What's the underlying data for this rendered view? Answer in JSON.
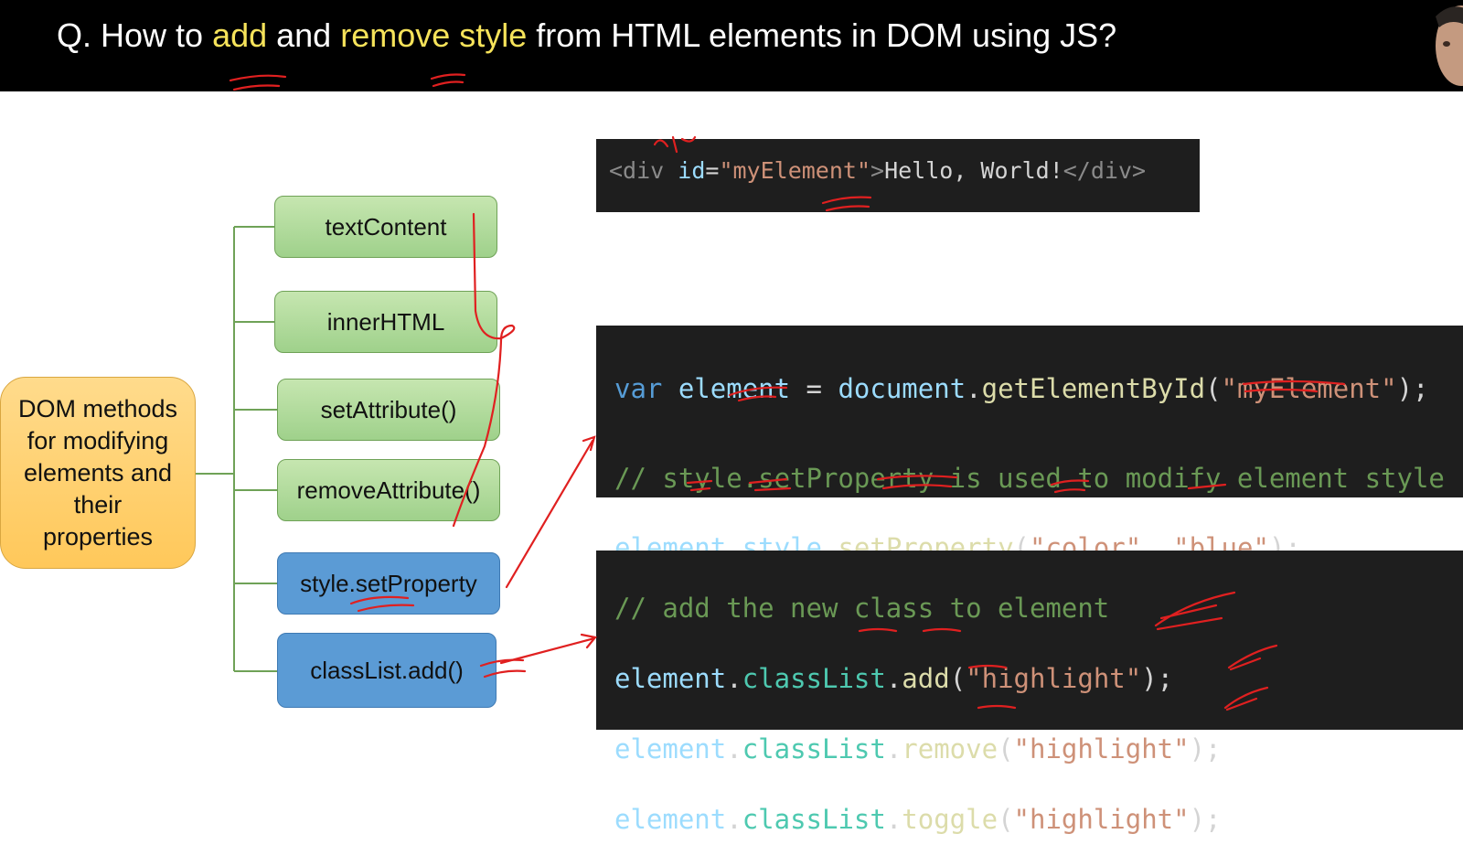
{
  "header": {
    "title_prefix": "Q. How to ",
    "title_word1": "add",
    "title_mid": " and ",
    "title_word2": "remove style",
    "title_suffix": " from HTML elements in DOM using JS?"
  },
  "diagram": {
    "root": {
      "line1": "DOM methods",
      "line2": "for modifying",
      "line3": "elements and",
      "line4": "their",
      "line5": "properties"
    },
    "children": [
      {
        "label": "textContent",
        "style": "green"
      },
      {
        "label": "innerHTML",
        "style": "green"
      },
      {
        "label": "setAttribute()",
        "style": "green"
      },
      {
        "label": "removeAttribute()",
        "style": "green"
      },
      {
        "label": "style.setProperty",
        "style": "blue"
      },
      {
        "label": "classList.add()",
        "style": "blue"
      }
    ]
  },
  "code_html": {
    "open_tag": "<div ",
    "attr_name": "id",
    "eq": "=",
    "attr_value": "\"myElement\"",
    "close_angle": ">",
    "text": "Hello, World!",
    "end_tag": "</div>"
  },
  "code_style": {
    "l1_kw": "var",
    "l1_var": " element",
    "l1_op": " = ",
    "l1_obj": "document",
    "l1_dot": ".",
    "l1_fn": "getElementById",
    "l1_open": "(",
    "l1_arg": "\"myElement\"",
    "l1_close": ");",
    "comment": "// style.setProperty is used to modify element style",
    "l3_obj": "element",
    "l3_dot1": ".",
    "l3_prop": "style",
    "l3_dot2": ".",
    "l3_fn": "setProperty",
    "l3_open": "(",
    "l3_arg1": "\"color\"",
    "l3_sep": ", ",
    "l3_arg2": "\"blue\"",
    "l3_close": ");"
  },
  "code_class": {
    "comment": "// add the new class to element",
    "lines": [
      {
        "obj": "element",
        "dot1": ".",
        "prop": "classList",
        "dot2": ".",
        "fn": "add",
        "open": "(",
        "arg": "\"highlight\"",
        "close": ");"
      },
      {
        "obj": "element",
        "dot1": ".",
        "prop": "classList",
        "dot2": ".",
        "fn": "remove",
        "open": "(",
        "arg": "\"highlight\"",
        "close": ");"
      },
      {
        "obj": "element",
        "dot1": ".",
        "prop": "classList",
        "dot2": ".",
        "fn": "toggle",
        "open": "(",
        "arg": "\"highlight\"",
        "close": ");"
      }
    ]
  },
  "colors": {
    "header_bg": "#000000",
    "title_highlight": "#f6e35a",
    "connector": "#6fa257",
    "annotation": "#e02020"
  }
}
